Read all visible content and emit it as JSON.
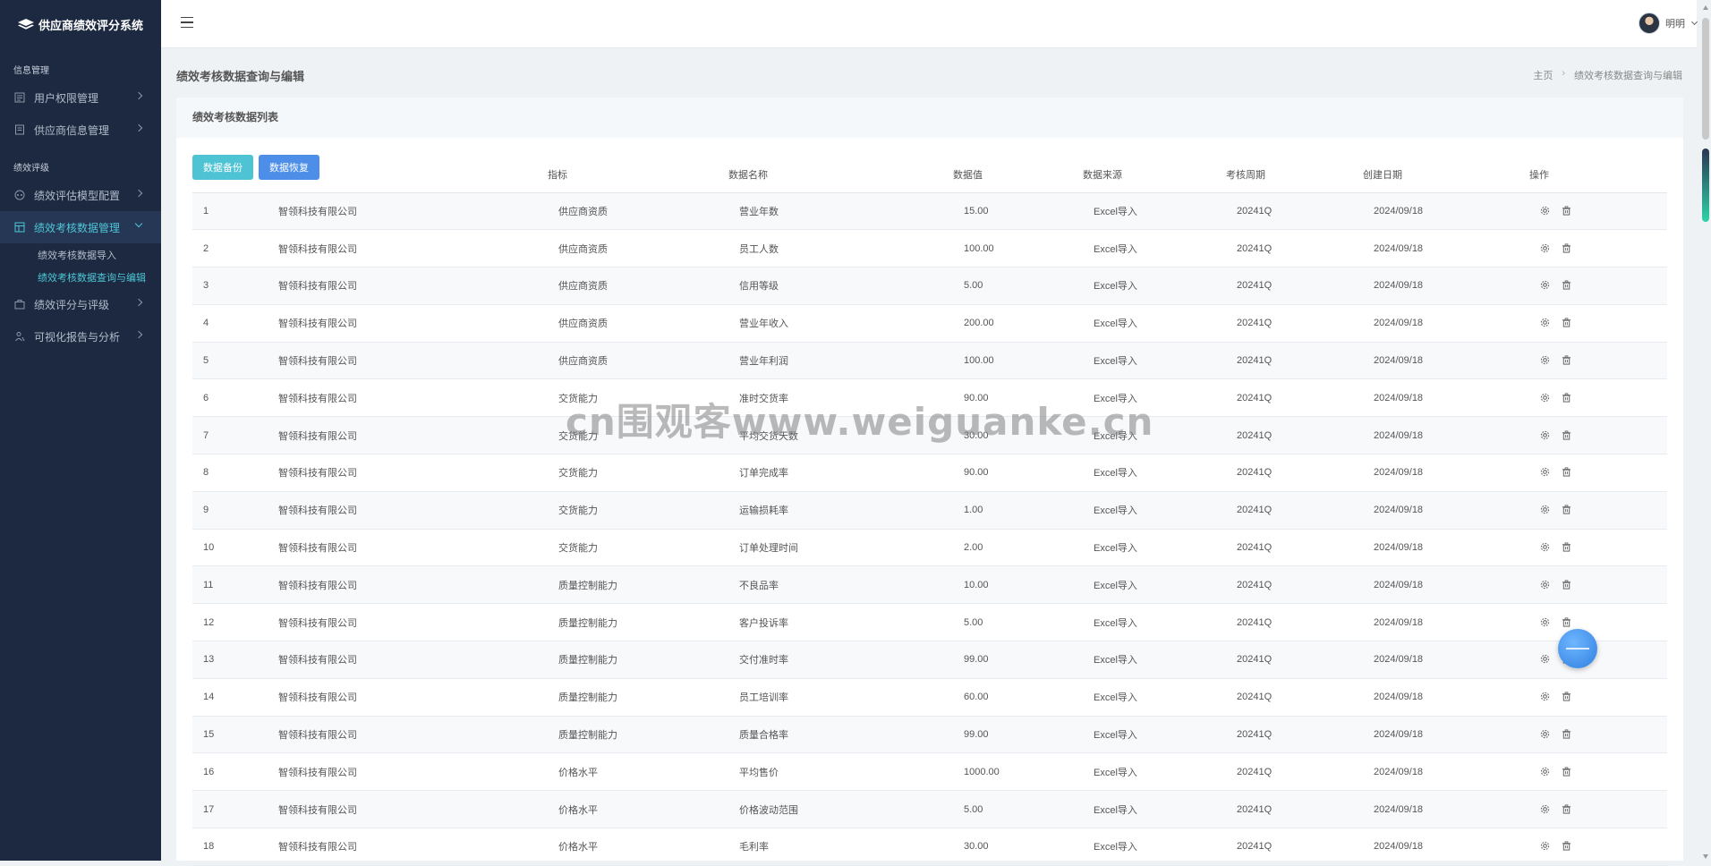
{
  "app": {
    "title": "供应商绩效评分系统"
  },
  "sidebar": {
    "sections": [
      {
        "label": "信息管理"
      },
      {
        "label": "绩效评级"
      }
    ],
    "items": [
      {
        "label": "用户权限管理",
        "icon": "user-list-icon"
      },
      {
        "label": "供应商信息管理",
        "icon": "document-icon"
      },
      {
        "label": "绩效评估模型配置",
        "icon": "settings-circle-icon"
      },
      {
        "label": "绩效考核数据管理",
        "icon": "table-icon",
        "active": true
      },
      {
        "label": "绩效评分与评级",
        "icon": "briefcase-icon"
      },
      {
        "label": "可视化报告与分析",
        "icon": "person-chart-icon"
      }
    ],
    "sub_items": [
      {
        "label": "绩效考核数据导入"
      },
      {
        "label": "绩效考核数据查询与编辑",
        "active": true
      }
    ]
  },
  "topbar": {
    "user_name": "明明"
  },
  "page": {
    "title": "绩效考核数据查询与编辑",
    "breadcrumb": [
      "主页",
      "绩效考核数据查询与编辑"
    ]
  },
  "card": {
    "title": "绩效考核数据列表",
    "buttons": {
      "export": "数据备份",
      "restore": "数据恢复"
    }
  },
  "table": {
    "headers": [
      "",
      "",
      "指标",
      "数据名称",
      "数据值",
      "数据来源",
      "考核周期",
      "创建日期",
      "操作"
    ],
    "rows": [
      [
        "1",
        "智领科技有限公司",
        "供应商资质",
        "营业年数",
        "15.00",
        "Excel导入",
        "20241Q",
        "2024/09/18"
      ],
      [
        "2",
        "智领科技有限公司",
        "供应商资质",
        "员工人数",
        "100.00",
        "Excel导入",
        "20241Q",
        "2024/09/18"
      ],
      [
        "3",
        "智领科技有限公司",
        "供应商资质",
        "信用等级",
        "5.00",
        "Excel导入",
        "20241Q",
        "2024/09/18"
      ],
      [
        "4",
        "智领科技有限公司",
        "供应商资质",
        "营业年收入",
        "200.00",
        "Excel导入",
        "20241Q",
        "2024/09/18"
      ],
      [
        "5",
        "智领科技有限公司",
        "供应商资质",
        "营业年利润",
        "100.00",
        "Excel导入",
        "20241Q",
        "2024/09/18"
      ],
      [
        "6",
        "智领科技有限公司",
        "交货能力",
        "准时交货率",
        "90.00",
        "Excel导入",
        "20241Q",
        "2024/09/18"
      ],
      [
        "7",
        "智领科技有限公司",
        "交货能力",
        "平均交货天数",
        "30.00",
        "Excel导入",
        "20241Q",
        "2024/09/18"
      ],
      [
        "8",
        "智领科技有限公司",
        "交货能力",
        "订单完成率",
        "90.00",
        "Excel导入",
        "20241Q",
        "2024/09/18"
      ],
      [
        "9",
        "智领科技有限公司",
        "交货能力",
        "运输损耗率",
        "1.00",
        "Excel导入",
        "20241Q",
        "2024/09/18"
      ],
      [
        "10",
        "智领科技有限公司",
        "交货能力",
        "订单处理时间",
        "2.00",
        "Excel导入",
        "20241Q",
        "2024/09/18"
      ],
      [
        "11",
        "智领科技有限公司",
        "质量控制能力",
        "不良品率",
        "10.00",
        "Excel导入",
        "20241Q",
        "2024/09/18"
      ],
      [
        "12",
        "智领科技有限公司",
        "质量控制能力",
        "客户投诉率",
        "5.00",
        "Excel导入",
        "20241Q",
        "2024/09/18"
      ],
      [
        "13",
        "智领科技有限公司",
        "质量控制能力",
        "交付准时率",
        "99.00",
        "Excel导入",
        "20241Q",
        "2024/09/18"
      ],
      [
        "14",
        "智领科技有限公司",
        "质量控制能力",
        "员工培训率",
        "60.00",
        "Excel导入",
        "20241Q",
        "2024/09/18"
      ],
      [
        "15",
        "智领科技有限公司",
        "质量控制能力",
        "质量合格率",
        "99.00",
        "Excel导入",
        "20241Q",
        "2024/09/18"
      ],
      [
        "16",
        "智领科技有限公司",
        "价格水平",
        "平均售价",
        "1000.00",
        "Excel导入",
        "20241Q",
        "2024/09/18"
      ],
      [
        "17",
        "智领科技有限公司",
        "价格水平",
        "价格波动范围",
        "5.00",
        "Excel导入",
        "20241Q",
        "2024/09/18"
      ],
      [
        "18",
        "智领科技有限公司",
        "价格水平",
        "毛利率",
        "30.00",
        "Excel导入",
        "20241Q",
        "2024/09/18"
      ]
    ],
    "row_actions": [
      "settings-icon",
      "delete-icon"
    ]
  },
  "watermark": "cn围观客www.weiguanke.cn",
  "colors": {
    "sidebar_bg": "#1c2940",
    "accent": "#4ec7d6",
    "primary": "#4c8ee8"
  }
}
